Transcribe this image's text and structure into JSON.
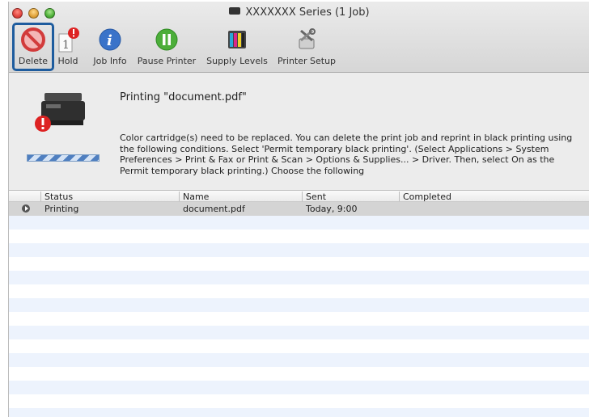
{
  "window": {
    "title": "XXXXXXX  Series (1 Job)"
  },
  "toolbar": {
    "delete_label": "Delete",
    "hold_label": "Hold",
    "job_info_label": "Job Info",
    "pause_label": "Pause Printer",
    "supply_label": "Supply Levels",
    "setup_label": "Printer Setup"
  },
  "message": {
    "title": "Printing \"document.pdf\"",
    "body": "Color cartridge(s) need to be replaced. You can delete the print job and reprint in black printing using the following conditions. Select 'Permit temporary black printing'. (Select Applications > System Preferences > Print & Fax or Print & Scan > Options & Supplies... > Driver. Then, select On as the Permit temporary black printing.) Choose the following"
  },
  "table": {
    "headers": {
      "status": "Status",
      "name": "Name",
      "sent": "Sent",
      "completed": "Completed"
    },
    "rows": [
      {
        "status": "Printing",
        "name": "document.pdf",
        "sent": "Today, 9:00",
        "completed": ""
      }
    ]
  },
  "colors": {
    "highlight_border": "#1e5c9e",
    "selected_row": "#d4d4d4",
    "stripe": "#edf3fd"
  },
  "icons": {
    "delete": "no-entry-icon",
    "hold": "hold-alert-icon",
    "job_info": "info-icon",
    "pause": "pause-icon",
    "supply": "ink-levels-icon",
    "setup": "tools-icon"
  }
}
